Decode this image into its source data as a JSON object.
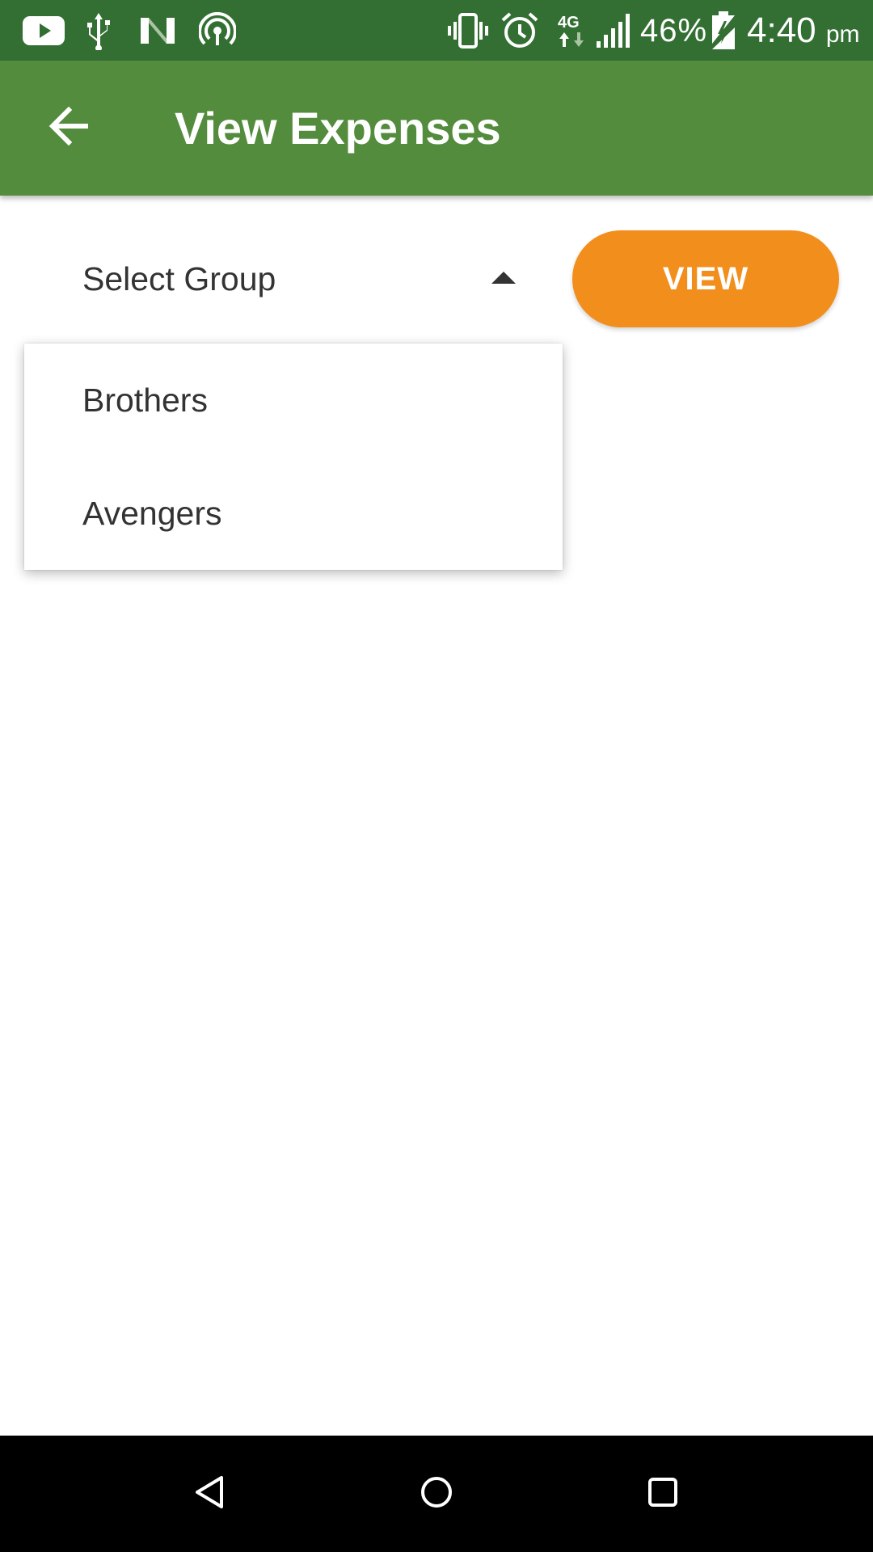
{
  "status_bar": {
    "icons": [
      "youtube-icon",
      "usb-icon",
      "n-logo-icon",
      "hotspot-icon",
      "vibrate-icon",
      "alarm-icon",
      "4g-data-icon",
      "signal-icon",
      "battery-charging-icon"
    ],
    "network": "4G",
    "battery_percent": "46%",
    "time": "4:40",
    "ampm": "pm"
  },
  "app_bar": {
    "title": "View Expenses",
    "back_icon": "arrow-back-icon"
  },
  "group_spinner": {
    "selected_label": "Select Group",
    "caret_icon": "arrow-up-icon",
    "options": [
      {
        "label": "Brothers"
      },
      {
        "label": "Avengers"
      }
    ]
  },
  "view_button": {
    "label": "VIEW"
  },
  "nav_bar": {
    "icons": [
      "back-icon",
      "home-icon",
      "recents-icon"
    ]
  },
  "colors": {
    "status_bar": "#336f33",
    "app_bar": "#548c3e",
    "accent": "#f28e1c",
    "text": "#333333"
  }
}
